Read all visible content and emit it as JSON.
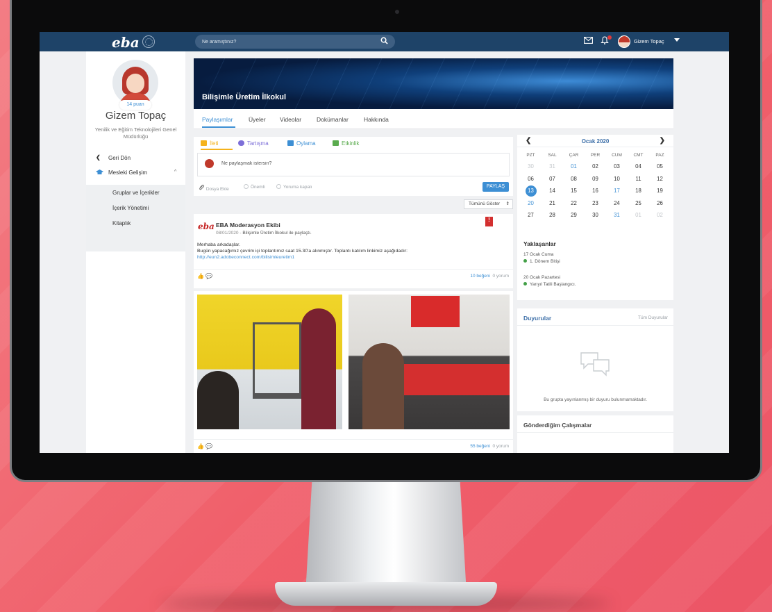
{
  "topbar": {
    "logo": "eba",
    "search_placeholder": "Ne aramıştınız?",
    "user_name": "Gizem Topaç",
    "icons": [
      "mail-icon",
      "bell-icon",
      "caret-down-icon"
    ]
  },
  "profile": {
    "points": "14 puan",
    "name": "Gizem Topaç",
    "org": "Yenilik ve Eğitim Teknolojileri Genel Müdürlüğü"
  },
  "sidebar": {
    "back": "Geri Dön",
    "section": "Mesleki Gelişim",
    "items": [
      "Gruplar ve İçerikler",
      "İçerik Yönetimi",
      "Kitaplık"
    ]
  },
  "group": {
    "title": "Bilişimle Üretim İlkokul",
    "tabs": [
      "Paylaşımlar",
      "Üyeler",
      "Videolar",
      "Dokümanlar",
      "Hakkında"
    ]
  },
  "composer": {
    "tabs": [
      "İleti",
      "Tartışma",
      "Oylama",
      "Etkinlik"
    ],
    "placeholder": "Ne paylaşmak istersin?",
    "attach": "Dosya Ekle",
    "important": "Önemli",
    "comments_closed": "Yoruma kapalı",
    "share": "PAYLAŞ",
    "filter": "Tümünü Göster"
  },
  "post1": {
    "logo": "eba",
    "author": "EBA Moderasyon Ekibi",
    "date": "08/01/2020",
    "sep": "-",
    "context": "Bilişimle Üretim İlkokul ile paylaştı.",
    "line1": "Merhaba arkadaşlar.",
    "line2": "Bugün yapacağımız çevrim içi toplantımız saat 15.30'a alınmıştır. Toplantı katılım linkimiz aşağıdadır:",
    "link": "http://eun2.adobeconnect.com/bilisimleuretim1",
    "likes": "10 beğeni",
    "comments": "0 yorum"
  },
  "post2": {
    "likes": "55 beğeni",
    "comments": "0 yorum"
  },
  "calendar": {
    "title": "Ocak 2020",
    "weekdays": [
      "PZT",
      "SAL",
      "ÇAR",
      "PER",
      "CUM",
      "CMT",
      "PAZ"
    ],
    "weeks": [
      [
        "30",
        "31",
        "01",
        "02",
        "03",
        "04",
        "05"
      ],
      [
        "06",
        "07",
        "08",
        "09",
        "10",
        "11",
        "12"
      ],
      [
        "13",
        "14",
        "15",
        "16",
        "17",
        "18",
        "19"
      ],
      [
        "20",
        "21",
        "22",
        "23",
        "24",
        "25",
        "26"
      ],
      [
        "27",
        "28",
        "29",
        "30",
        "31",
        "01",
        "02"
      ]
    ],
    "today": "13"
  },
  "upcoming": {
    "title": "Yaklaşanlar",
    "events": [
      {
        "date": "17 Ocak Cuma",
        "name": "1. Dönem Bitişi"
      },
      {
        "date": "20 Ocak Pazartesi",
        "name": "Yarıyıl Tatili Başlangıcı."
      }
    ]
  },
  "announcements": {
    "title": "Duyurular",
    "all_link": "Tüm Duyurular",
    "empty": "Bu grupta yayınlanmış bir duyuru bulunmamaktadır."
  },
  "submitted": {
    "title": "Gönderdiğim Çalışmalar"
  },
  "colors": {
    "topbar": "#1e4368",
    "accent": "#3d8fd4",
    "brand_red": "#c62828",
    "background": "#f0606b"
  }
}
